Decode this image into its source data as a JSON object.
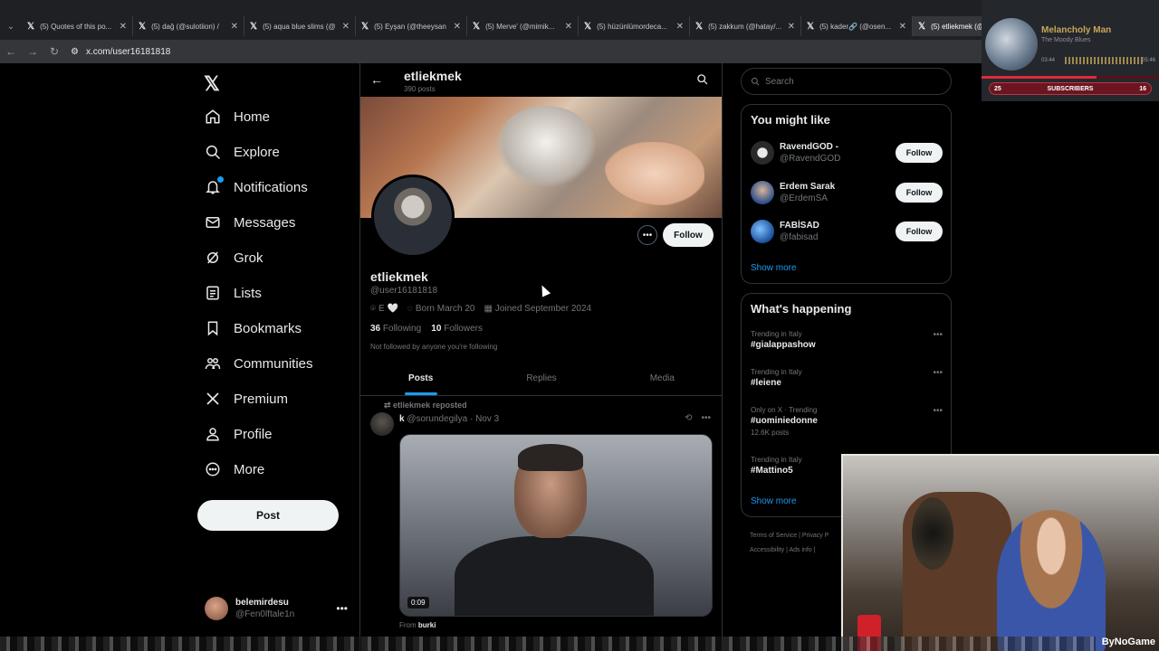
{
  "browser": {
    "tabs": [
      {
        "label": "(5) Quotes of this po..."
      },
      {
        "label": "(5) dağ (@sulotiion) /"
      },
      {
        "label": "(5) aqua blue slims (@"
      },
      {
        "label": "(5) Eyşan (@theeysan"
      },
      {
        "label": "(5) Merve' (@mimik..."
      },
      {
        "label": "(5) hüzünlümordeca..."
      },
      {
        "label": "(5) zakkum (@hatay/..."
      },
      {
        "label": "(5) kader🔗 (@osen..."
      },
      {
        "label": "(5) etliekmek (@..."
      }
    ],
    "url": "x.com/user16181818"
  },
  "music_widget": {
    "song": "Melancholy Man",
    "artist": "The Moody Blues",
    "time_current": "03:44",
    "time_total": "05:46",
    "progress": 0.65,
    "subscribers_left": "25",
    "subscribers_label": "SUBSCRIBERS",
    "subscribers_right": "16"
  },
  "nav": {
    "items": [
      {
        "label": "Home",
        "icon": "home-icon"
      },
      {
        "label": "Explore",
        "icon": "search-icon"
      },
      {
        "label": "Notifications",
        "icon": "bell-icon"
      },
      {
        "label": "Messages",
        "icon": "mail-icon"
      },
      {
        "label": "Grok",
        "icon": "grok-icon"
      },
      {
        "label": "Lists",
        "icon": "list-icon"
      },
      {
        "label": "Bookmarks",
        "icon": "bookmark-icon"
      },
      {
        "label": "Communities",
        "icon": "communities-icon"
      },
      {
        "label": "Premium",
        "icon": "x-icon"
      },
      {
        "label": "Profile",
        "icon": "person-icon"
      },
      {
        "label": "More",
        "icon": "more-circle-icon"
      }
    ],
    "post_label": "Post",
    "account_name": "belemirdesu",
    "account_handle": "@Fen0lftale1n"
  },
  "profile": {
    "header_name": "etliekmek",
    "post_count": "390 posts",
    "follow_label": "Follow",
    "display_name": "etliekmek",
    "handle": "@user16181818",
    "location": "E 🤍",
    "born": "Born March 20",
    "joined": "Joined September 2024",
    "following_count": "36",
    "following_label": "Following",
    "followers_count": "10",
    "followers_label": "Followers",
    "not_followed": "Not followed by anyone you're following",
    "tabs": [
      "Posts",
      "Replies",
      "Media"
    ]
  },
  "tweet": {
    "repost_label": "etliekmek reposted",
    "author": "k",
    "handle_date": "@sorundegilya · Nov 3",
    "duration": "0:09",
    "from_label": "From",
    "from_user": "burki"
  },
  "sidebar": {
    "search_placeholder": "Search",
    "you_might_like": "You might like",
    "suggestions": [
      {
        "name": "RavendGOD -",
        "handle": "@RavendGOD",
        "button": "Follow"
      },
      {
        "name": "Erdem Sarak",
        "handle": "@ErdemSA",
        "button": "Follow"
      },
      {
        "name": "FABİSAD",
        "handle": "@fabisad",
        "button": "Follow"
      }
    ],
    "show_more": "Show more",
    "whats_happening": "What's happening",
    "trends": [
      {
        "context": "Trending in Italy",
        "name": "#gialappashow",
        "posts": ""
      },
      {
        "context": "Trending in Italy",
        "name": "#leiene",
        "posts": ""
      },
      {
        "context": "Only on X · Trending",
        "name": "#uominiedonne",
        "posts": "12.6K posts"
      },
      {
        "context": "Trending in Italy",
        "name": "#Mattino5",
        "posts": ""
      }
    ],
    "show_more_2": "Show more",
    "footer_links_1": "Terms of Service  |  Privacy P",
    "footer_links_2": "Accessibility  |  Ads info  |"
  },
  "watermark": "ByNoGame"
}
